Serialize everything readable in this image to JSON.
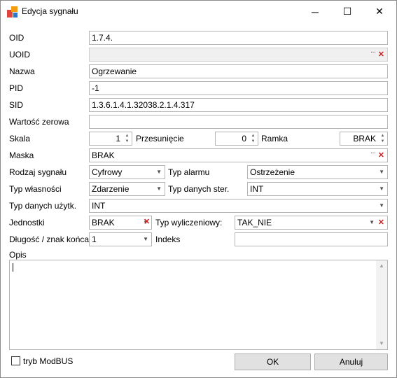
{
  "window": {
    "title": "Edycja sygnału",
    "icon": "app-logo-icon",
    "controls": {
      "minimize": "─",
      "maximize": "☐",
      "close": "✕"
    }
  },
  "fields": {
    "oid": {
      "label": "OID",
      "value": "1.7.4."
    },
    "uoid": {
      "label": "UOID",
      "value": ""
    },
    "nazwa": {
      "label": "Nazwa",
      "value": "Ogrzewanie"
    },
    "pid": {
      "label": "PID",
      "value": "-1"
    },
    "sid": {
      "label": "SID",
      "value": "1.3.6.1.4.1.32038.2.1.4.317"
    },
    "wartosc_zerowa": {
      "label": "Wartość zerowa",
      "value": ""
    },
    "skala": {
      "label": "Skala",
      "value": "1"
    },
    "przesuniecie": {
      "label": "Przesunięcie",
      "value": "0"
    },
    "ramka": {
      "label": "Ramka",
      "value": "BRAK"
    },
    "maska": {
      "label": "Maska",
      "value": "BRAK"
    },
    "rodzaj_sygnalu": {
      "label": "Rodzaj sygnału",
      "value": "Cyfrowy"
    },
    "typ_alarmu": {
      "label": "Typ alarmu",
      "value": "Ostrzeżenie"
    },
    "typ_wlasnosci": {
      "label": "Typ własności",
      "value": "Zdarzenie"
    },
    "typ_danych_ster": {
      "label": "Typ danych ster.",
      "value": "INT"
    },
    "typ_danych_uzytk": {
      "label": "Typ danych użytk.",
      "value": "INT"
    },
    "jednostki": {
      "label": "Jednostki",
      "value": "BRAK"
    },
    "typ_wyliczeniowy": {
      "label": "Typ wyliczeniowy:",
      "value": "TAK_NIE"
    },
    "dlugosc_znak_konca": {
      "label": "Długość / znak końca",
      "value": "1"
    },
    "indeks": {
      "label": "Indeks",
      "value": ""
    },
    "opis": {
      "label": "Opis",
      "value": ""
    }
  },
  "symbols": {
    "ellipsis": "···",
    "clear": "✕",
    "dropdown": "▼",
    "spin_up": "▲",
    "spin_down": "▼"
  },
  "footer": {
    "modbus_label": "tryb ModBUS",
    "modbus_checked": false,
    "ok_label": "OK",
    "cancel_label": "Anuluj"
  },
  "colors": {
    "clear_red": "#d21e1e",
    "icon_red": "#e0443e",
    "icon_orange": "#f39c12",
    "icon_blue": "#2e75c9"
  }
}
